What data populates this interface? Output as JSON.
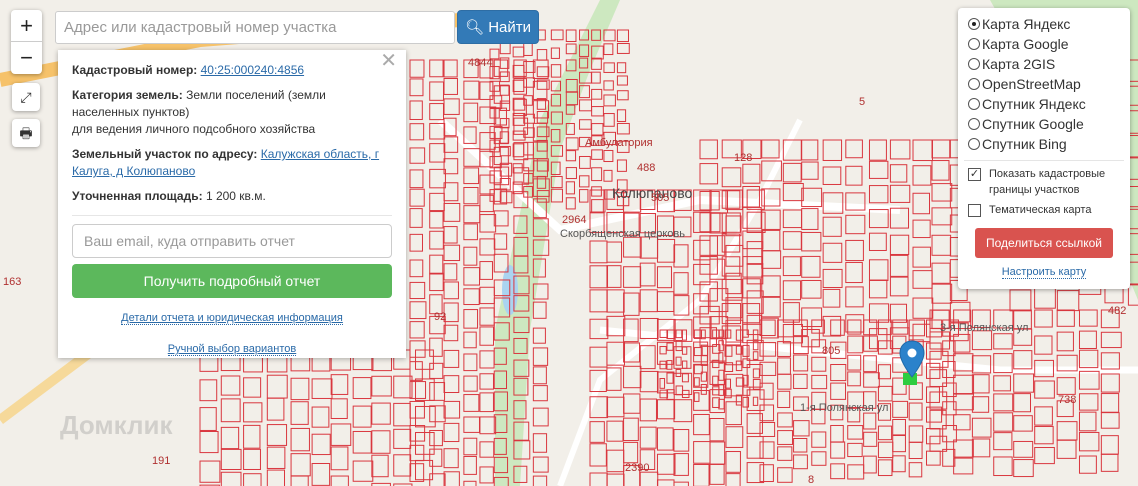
{
  "map": {
    "labels": [
      {
        "text": "4844",
        "cls": ""
      },
      {
        "text": "5",
        "cls": ""
      },
      {
        "text": "Колюпаново",
        "cls": "dark"
      },
      {
        "text": "488",
        "cls": ""
      },
      {
        "text": "505",
        "cls": ""
      },
      {
        "text": "128",
        "cls": ""
      },
      {
        "text": "2964",
        "cls": ""
      },
      {
        "text": "Скорбященская церковь",
        "cls": "gray"
      },
      {
        "text": "Амбулатория",
        "cls": ""
      },
      {
        "text": "92",
        "cls": ""
      },
      {
        "text": "805",
        "cls": ""
      },
      {
        "text": "3-я Полянская ул",
        "cls": "gray"
      },
      {
        "text": "1-я Полянская ул",
        "cls": "gray"
      },
      {
        "text": "738",
        "cls": ""
      },
      {
        "text": "2390",
        "cls": ""
      },
      {
        "text": "191",
        "cls": ""
      },
      {
        "text": "8",
        "cls": ""
      },
      {
        "text": "482",
        "cls": ""
      },
      {
        "text": "163",
        "cls": ""
      }
    ],
    "watermark": "Домклик",
    "colors": {
      "parcel": "#d9363e",
      "road": "#ffffff",
      "green": "#cde8c0",
      "water": "#aad3f0"
    }
  },
  "controls": {
    "zoom_in": "+",
    "zoom_out": "−",
    "fullscreen_icon": "⤢",
    "print_icon": "🖶"
  },
  "search": {
    "placeholder": "Адрес или кадастровый номер участка",
    "button": "Найти"
  },
  "popup": {
    "cad_label": "Кадастровый номер:",
    "cad_value": "40:25:000240:4856",
    "cat_label": "Категория земель:",
    "cat_value": "Земли поселений (земли населенных пунктов)",
    "use": "для ведения личного подсобного хозяйства",
    "addr_label": "Земельный участок по адресу:",
    "addr_value": "Калужская область, г Калуга, д Колюпаново",
    "area_label": "Уточненная площадь:",
    "area_value": "1 200 кв.м.",
    "email_placeholder": "Ваш email, куда отправить отчет",
    "report_button": "Получить подробный отчет",
    "details_link": "Детали отчета и юридическая информация",
    "manual_link": "Ручной выбор вариантов"
  },
  "layers": {
    "options": [
      {
        "label": "Карта Яндекс",
        "selected": true
      },
      {
        "label": "Карта Google",
        "selected": false
      },
      {
        "label": "Карта 2GIS",
        "selected": false
      },
      {
        "label": "OpenStreetMap",
        "selected": false
      },
      {
        "label": "Спутник Яндекс",
        "selected": false
      },
      {
        "label": "Спутник Google",
        "selected": false
      },
      {
        "label": "Спутник Bing",
        "selected": false
      }
    ],
    "show_borders": "Показать кадастровые границы участков",
    "show_borders_checked": true,
    "thematic": "Тематическая карта",
    "thematic_checked": false,
    "share": "Поделиться ссылкой",
    "configure": "Настроить карту"
  }
}
